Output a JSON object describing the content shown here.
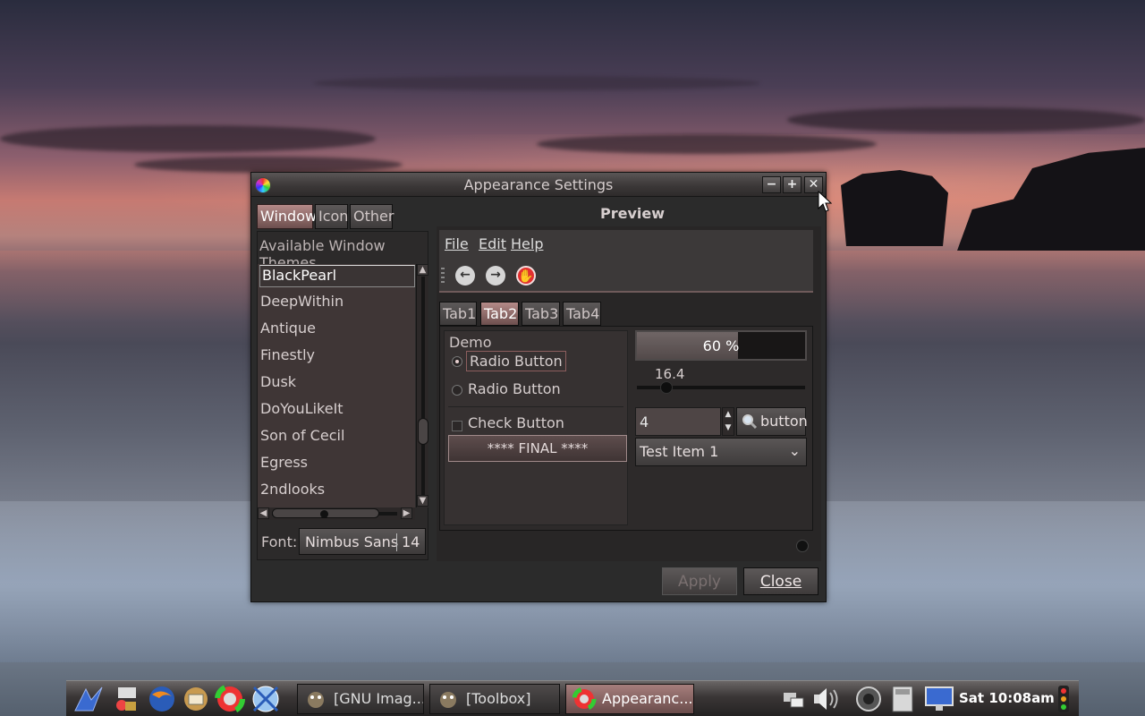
{
  "window": {
    "title": "Appearance Settings",
    "minimize": "−",
    "maximize": "+",
    "close": "✕"
  },
  "left": {
    "tabs": [
      "Window",
      "Icon",
      "Other"
    ],
    "list_heading": "Available Window Themes",
    "themes": [
      "BlackPearl",
      "DeepWithin",
      "Antique",
      "Finestly",
      "Dusk",
      "DoYouLikeIt",
      "Son of Cecil",
      "Egress",
      "2ndlooks"
    ],
    "selected_theme": "BlackPearl",
    "font_label": "Font:",
    "font_name": "Nimbus Sans",
    "font_size": "14"
  },
  "preview": {
    "label": "Preview",
    "menu": [
      "File",
      "Edit",
      "Help"
    ],
    "tabs": [
      "Tab1",
      "Tab2",
      "Tab3",
      "Tab4"
    ],
    "active_tab": "Tab2",
    "demo_label": "Demo",
    "radio1": "Radio Button",
    "radio2": "Radio Button",
    "check": "Check Button",
    "final_button": "**** FINAL ****",
    "progress_text": "60 %",
    "progress_value": 0.6,
    "scale_value": "16.4",
    "spin_value": "4",
    "find_button": "button",
    "combo_value": "Test Item 1"
  },
  "buttons": {
    "apply": "Apply",
    "close": "Close"
  },
  "taskbar": {
    "tasks": [
      "[GNU Imag...",
      "[Toolbox]",
      "Appearanc..."
    ],
    "clock": "Sat 10:08am"
  },
  "colors": {
    "accent": "#b48a88",
    "window_bg": "#2b2b2b"
  }
}
